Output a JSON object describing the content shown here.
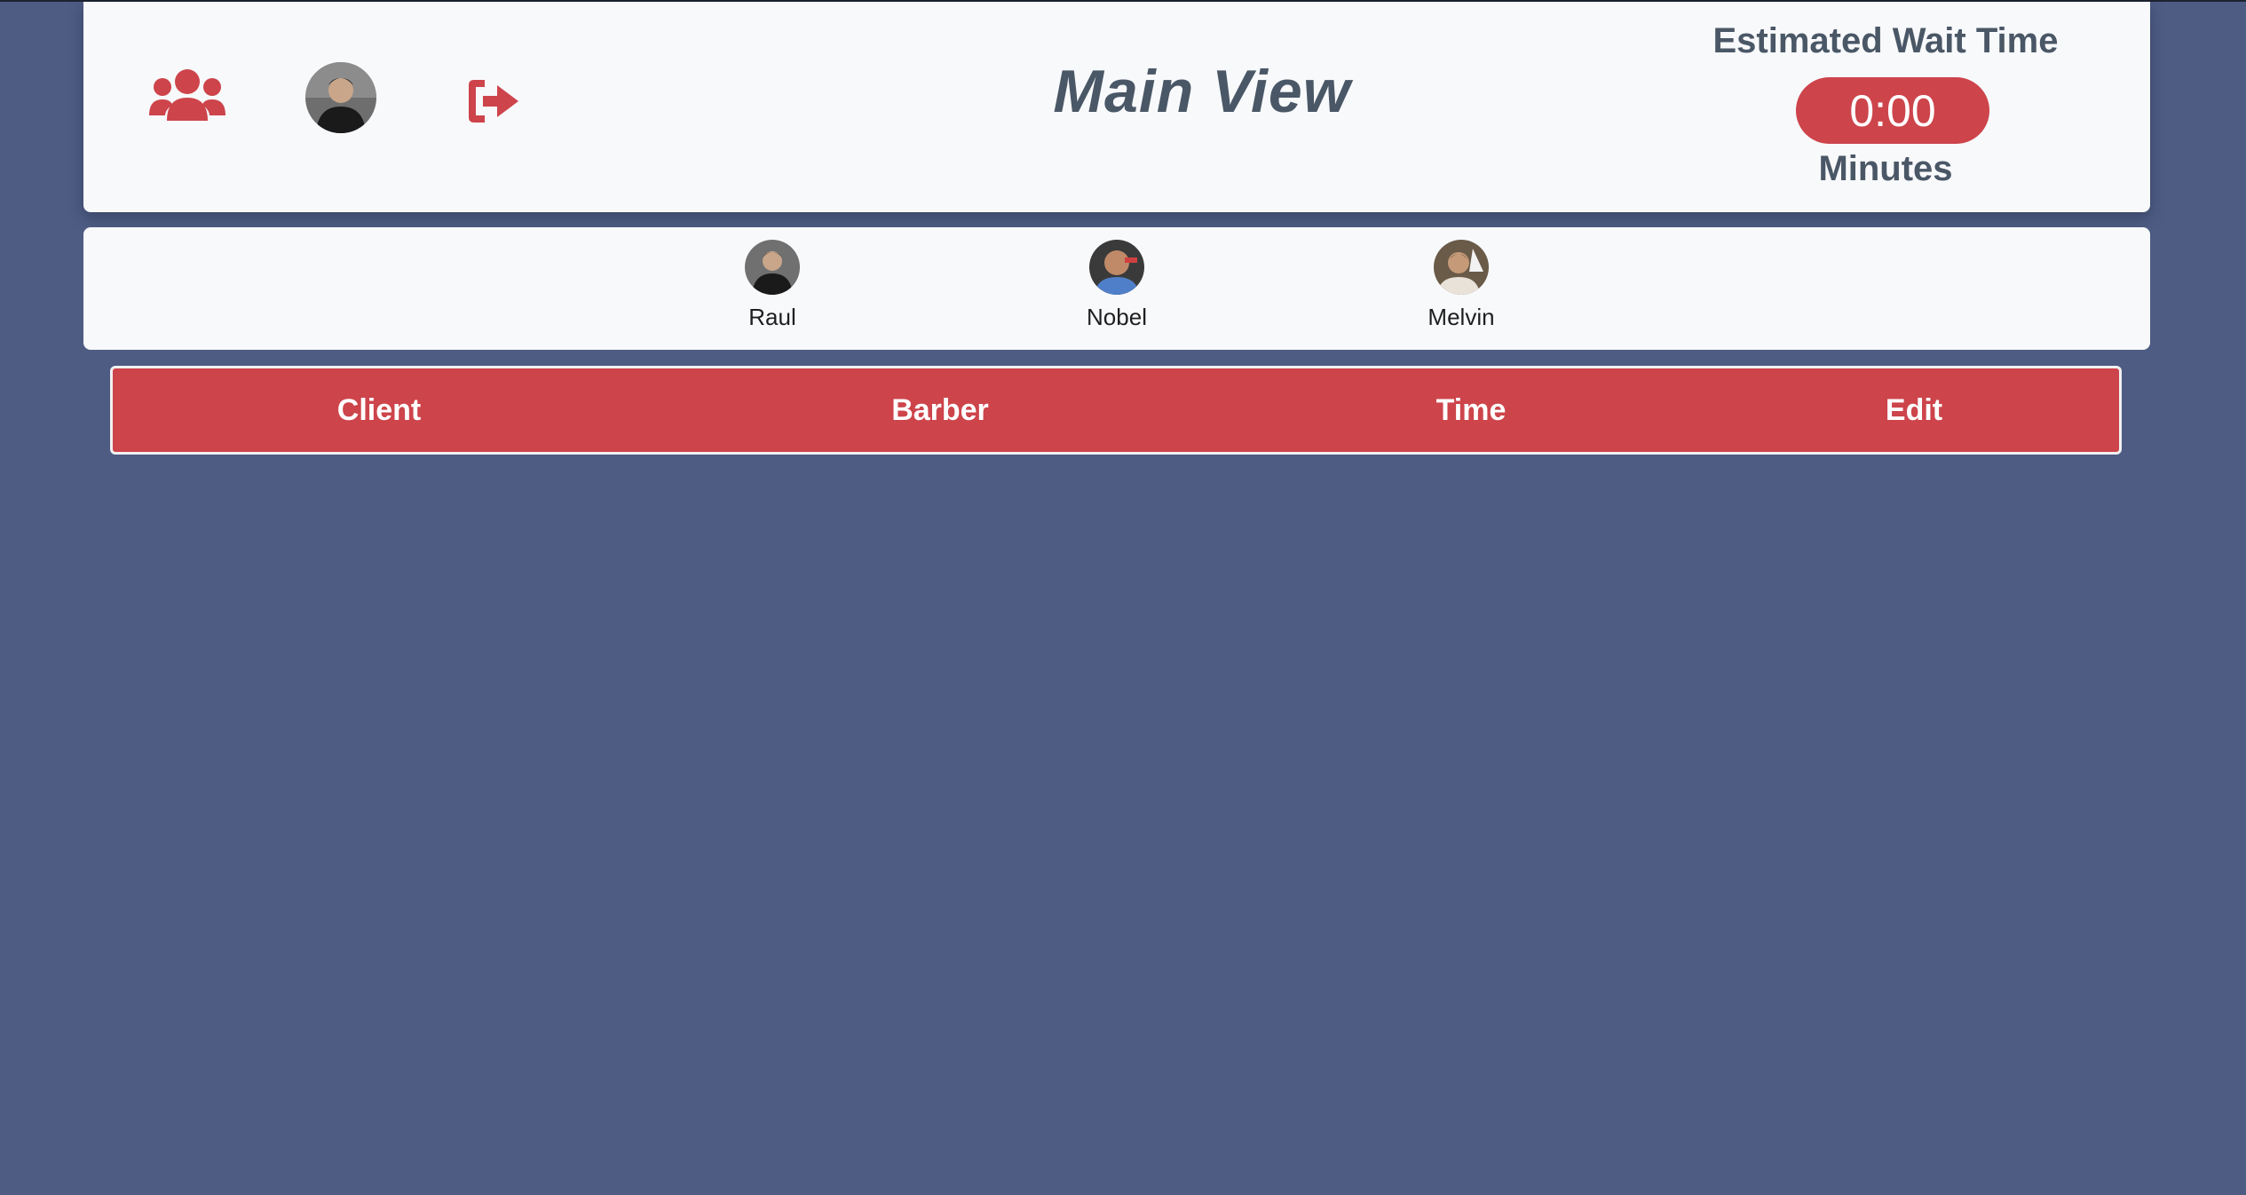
{
  "colors": {
    "background": "#4e5c84",
    "panel": "#f8f9fb",
    "accent": "#cd444b",
    "title_text": "#4a5766"
  },
  "header": {
    "title": "Main View",
    "icons": {
      "users": "users-icon",
      "profile": "avatar",
      "logout": "sign-out-icon"
    },
    "wait": {
      "label": "Estimated Wait Time",
      "value": "0:00",
      "unit": "Minutes"
    }
  },
  "barbers": [
    {
      "name": "Raul"
    },
    {
      "name": "Nobel"
    },
    {
      "name": "Melvin"
    }
  ],
  "table": {
    "columns": [
      "Client",
      "Barber",
      "Time",
      "Edit"
    ]
  }
}
